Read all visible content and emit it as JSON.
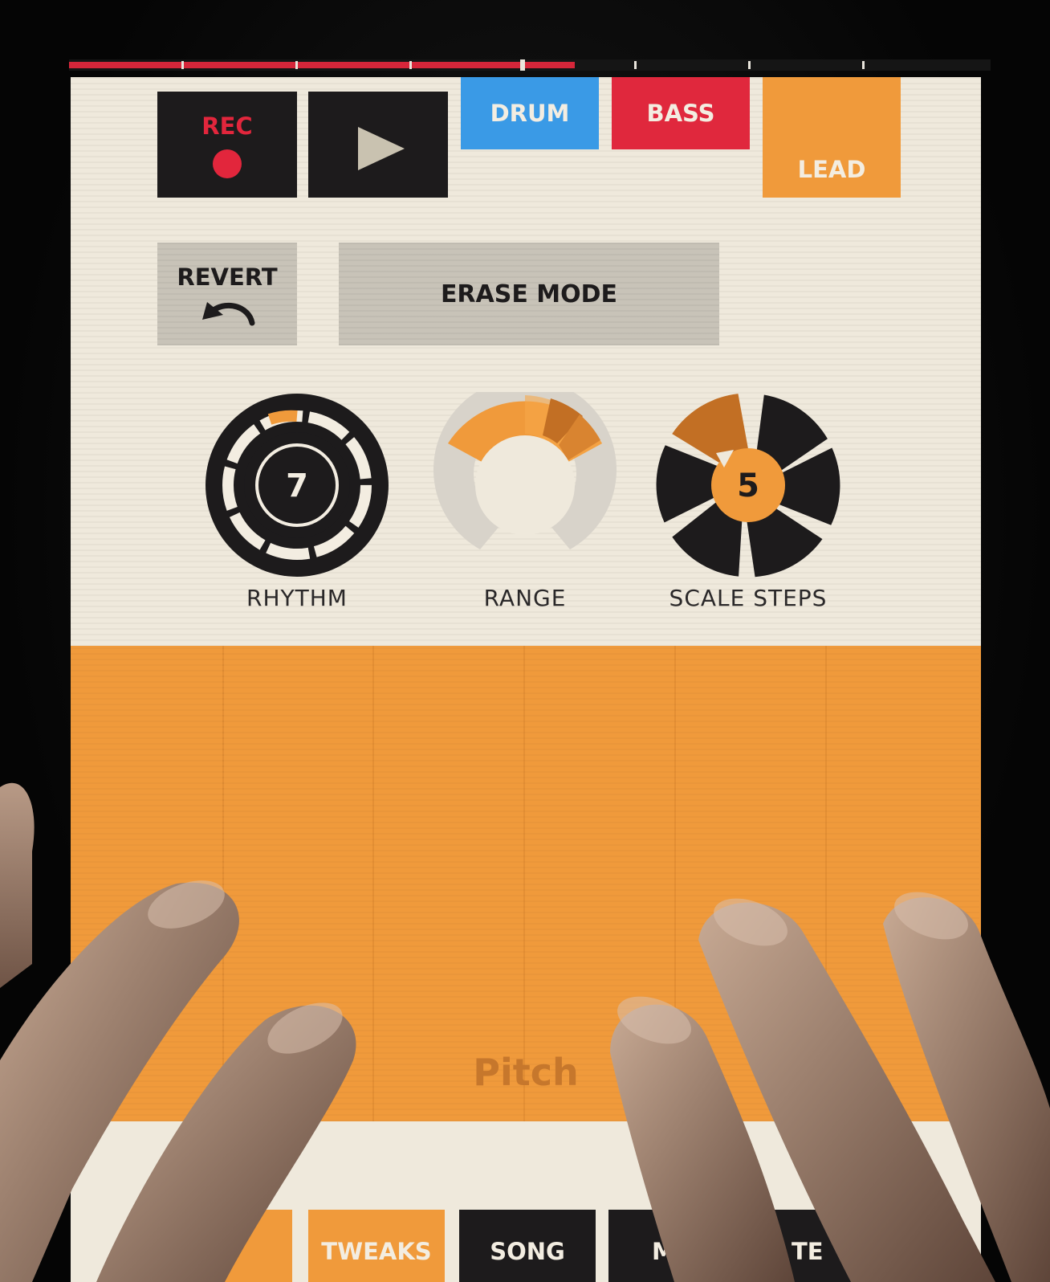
{
  "transport": {
    "rec_label": "REC",
    "progress_percent": 49
  },
  "instruments": [
    {
      "label": "DRUM",
      "color": "#3a9ae6"
    },
    {
      "label": "BASS",
      "color": "#e0283d"
    },
    {
      "label": "LEAD",
      "color": "#f09a3b"
    }
  ],
  "actions": {
    "revert_label": "REVERT",
    "erase_label": "ERASE MODE"
  },
  "knobs": {
    "rhythm": {
      "label": "RHYTHM",
      "value": "7"
    },
    "range": {
      "label": "RANGE"
    },
    "scale_steps": {
      "label": "SCALE STEPS",
      "value": "5"
    }
  },
  "pad_area": {
    "label": "Pitch",
    "columns": 6
  },
  "bottom_tabs": [
    {
      "label": "TWEAKS",
      "color": "#f09a3b"
    },
    {
      "label": "SONG",
      "color": "#1d1b1c"
    },
    {
      "label": "M",
      "color": "#1d1b1c"
    },
    {
      "label": "TE",
      "color": "#1d1b1c"
    }
  ],
  "colors": {
    "accent": "#f09a3b",
    "dark": "#1d1b1c",
    "background": "#efe9dc",
    "rec": "#e2263c"
  }
}
